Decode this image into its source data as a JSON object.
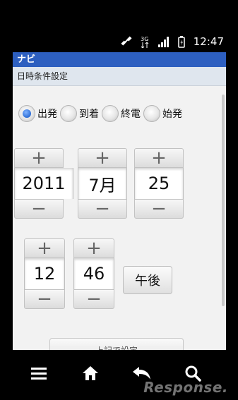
{
  "status_bar": {
    "time": "12:47",
    "network_label": "3G",
    "icons": [
      "gps-icon",
      "network-3g-icon",
      "signal-icon",
      "battery-icon"
    ]
  },
  "app": {
    "title": "ナビ",
    "section_title": "日時条件設定",
    "radio_options": [
      {
        "label": "出発",
        "selected": true
      },
      {
        "label": "到着",
        "selected": false
      },
      {
        "label": "終電",
        "selected": false
      },
      {
        "label": "始発",
        "selected": false
      }
    ],
    "spinner_plus": "+",
    "spinner_minus": "−",
    "date": {
      "year": "2011",
      "month": "7月",
      "day": "25"
    },
    "time": {
      "hour": "12",
      "minute": "46"
    },
    "ampm": "午後",
    "set_button": "上記で設定"
  },
  "nav_bar": {
    "icons": [
      "menu-icon",
      "home-icon",
      "back-icon",
      "search-icon"
    ]
  },
  "watermark": "Response.",
  "colors": {
    "titlebar": "#2d5fc0",
    "radio_selected": "#2f6fd6"
  }
}
